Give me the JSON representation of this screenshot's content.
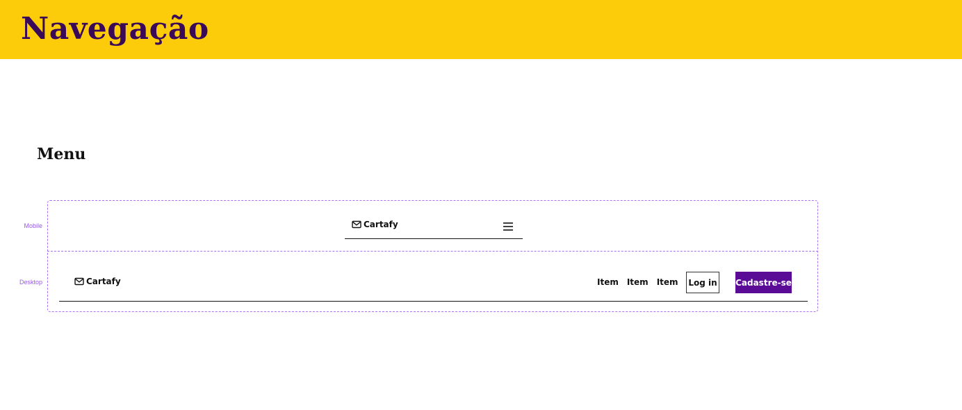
{
  "header": {
    "title": "Navegação",
    "background": "#fccc0a",
    "title_color": "#3a0a58"
  },
  "section": {
    "title": "Menu"
  },
  "variants": {
    "mobile_label": "Mobile",
    "desktop_label": "Desktop",
    "frame_color": "#a970f0"
  },
  "mobile_nav": {
    "brand": "Cartafy",
    "brand_icon": "mail-icon",
    "menu_icon": "hamburger-menu-icon"
  },
  "desktop_nav": {
    "brand": "Cartafy",
    "brand_icon": "mail-icon",
    "items": [
      "Item",
      "Item",
      "Item"
    ],
    "login_label": "Log in",
    "signup_label": "Cadastre-se",
    "signup_color": "#5b0c96"
  }
}
